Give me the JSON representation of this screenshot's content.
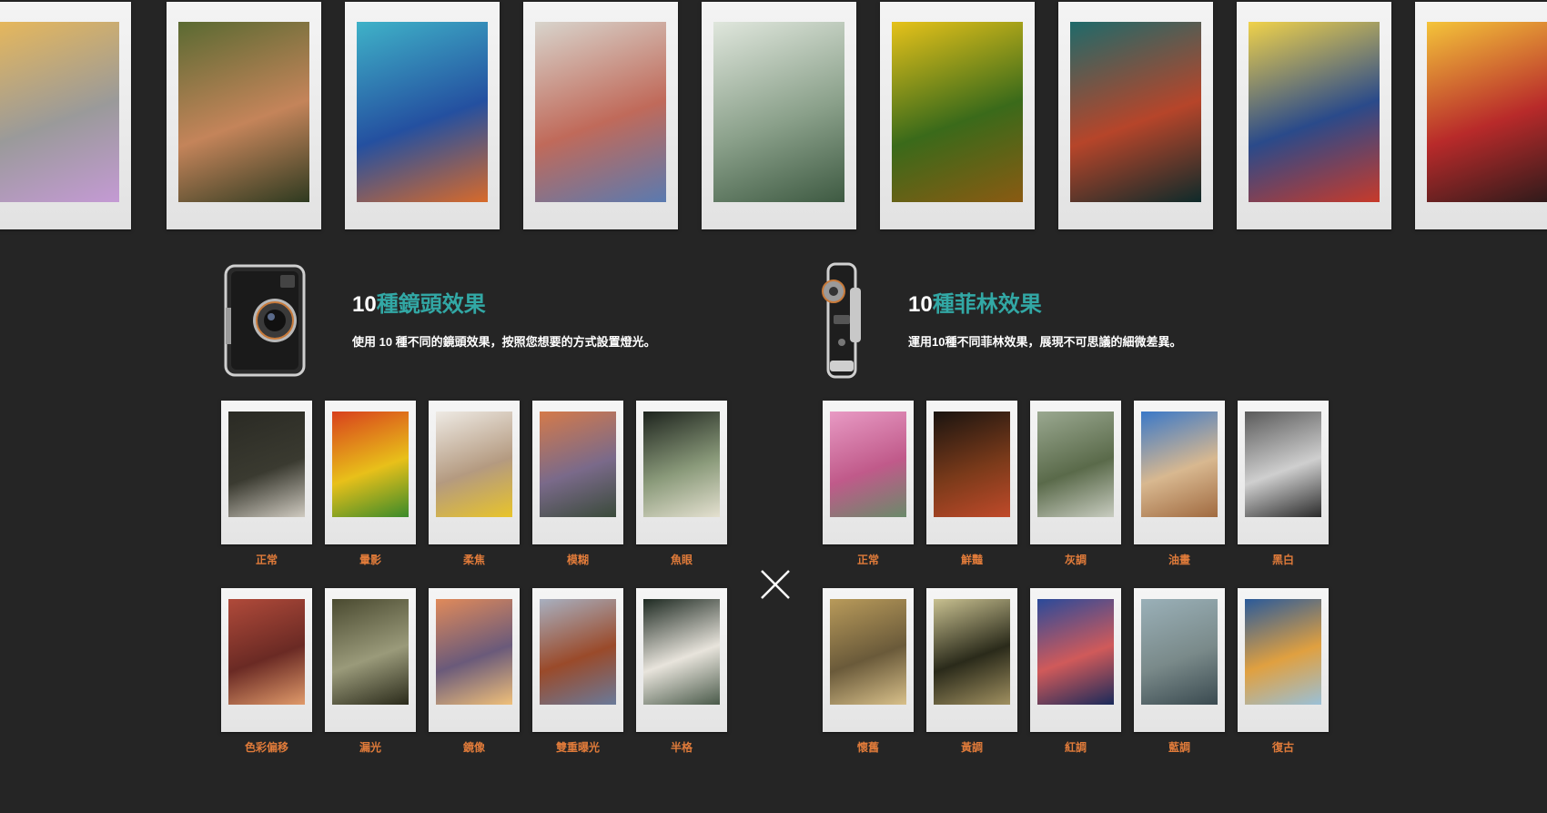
{
  "strip_photos": [
    {
      "colors": [
        "#e8b85a",
        "#9a9a9a",
        "#c49ad4"
      ]
    },
    {
      "colors": [
        "#5a6a32",
        "#c4845a",
        "#2e3a20"
      ]
    },
    {
      "colors": [
        "#3fb2c8",
        "#2450a0",
        "#d86a2a"
      ]
    },
    {
      "colors": [
        "#d8d4cc",
        "#c06a5a",
        "#5a7ab0"
      ]
    },
    {
      "colors": [
        "#dfe6dc",
        "#8aa08a",
        "#3e5a42"
      ]
    },
    {
      "colors": [
        "#e6c21a",
        "#3a6a1a",
        "#8a5a12"
      ]
    },
    {
      "colors": [
        "#1f6a6a",
        "#b6452a",
        "#0e2a2a"
      ]
    },
    {
      "colors": [
        "#f0d24a",
        "#2a4a8a",
        "#c83a2a"
      ]
    },
    {
      "colors": [
        "#f4c43a",
        "#b82a2a",
        "#2a1a1a"
      ]
    }
  ],
  "lens": {
    "title_number": "10",
    "title_text": "種鏡頭效果",
    "description": "使用 10 種不同的鏡頭效果，按照您想要的方式設置燈光。",
    "items": [
      {
        "label": "正常",
        "colors": [
          "#2a2a24",
          "#3a3a30",
          "#cfcac0"
        ]
      },
      {
        "label": "暈影",
        "colors": [
          "#d8401c",
          "#e8c01a",
          "#3a8a2a"
        ]
      },
      {
        "label": "柔焦",
        "colors": [
          "#eeeae4",
          "#b49a80",
          "#e8c42a"
        ]
      },
      {
        "label": "模糊",
        "colors": [
          "#d47a4a",
          "#7a6a8a",
          "#3a4a3a"
        ]
      },
      {
        "label": "魚眼",
        "colors": [
          "#1e241e",
          "#8a9a7a",
          "#e4e0d0"
        ]
      },
      {
        "label": "色彩偏移",
        "colors": [
          "#b04a3a",
          "#6a2a24",
          "#e09a6a"
        ]
      },
      {
        "label": "漏光",
        "colors": [
          "#4a4a30",
          "#9a9a7a",
          "#2a2a1a"
        ]
      },
      {
        "label": "鏡像",
        "colors": [
          "#e08a5a",
          "#6a5a7a",
          "#f0c07a"
        ]
      },
      {
        "label": "雙重曝光",
        "colors": [
          "#a8b0c0",
          "#9a4a2a",
          "#6a7a9a"
        ]
      },
      {
        "label": "半格",
        "colors": [
          "#1e2a22",
          "#e8e4dc",
          "#4a5a4a"
        ]
      }
    ]
  },
  "film": {
    "title_number": "10",
    "title_text": "種菲林效果",
    "description": "運用10種不同菲林效果，展現不可思議的細微差異。",
    "items": [
      {
        "label": "正常",
        "colors": [
          "#e89ac4",
          "#c05a8a",
          "#6a8a6a"
        ]
      },
      {
        "label": "鮮豔",
        "colors": [
          "#1a1410",
          "#7a3a1a",
          "#c04a2a"
        ]
      },
      {
        "label": "灰調",
        "colors": [
          "#9aa890",
          "#5a6a4a",
          "#c8ccc0"
        ]
      },
      {
        "label": "油畫",
        "colors": [
          "#3a78c8",
          "#d8b890",
          "#a06a40"
        ]
      },
      {
        "label": "黑白",
        "colors": [
          "#5a5a5a",
          "#cfcfcf",
          "#2a2a2a"
        ]
      },
      {
        "label": "懷舊",
        "colors": [
          "#b89a5a",
          "#6a5a3a",
          "#d8c08a"
        ]
      },
      {
        "label": "黃調",
        "colors": [
          "#c8c090",
          "#2a2a1a",
          "#a09060"
        ]
      },
      {
        "label": "紅調",
        "colors": [
          "#2a4a9a",
          "#d05a5a",
          "#1a2a5a"
        ]
      },
      {
        "label": "藍調",
        "colors": [
          "#9ab0b8",
          "#7a8a8a",
          "#3a4a50"
        ]
      },
      {
        "label": "復古",
        "colors": [
          "#2a5a9a",
          "#e0a040",
          "#9ac0d8"
        ]
      }
    ]
  }
}
